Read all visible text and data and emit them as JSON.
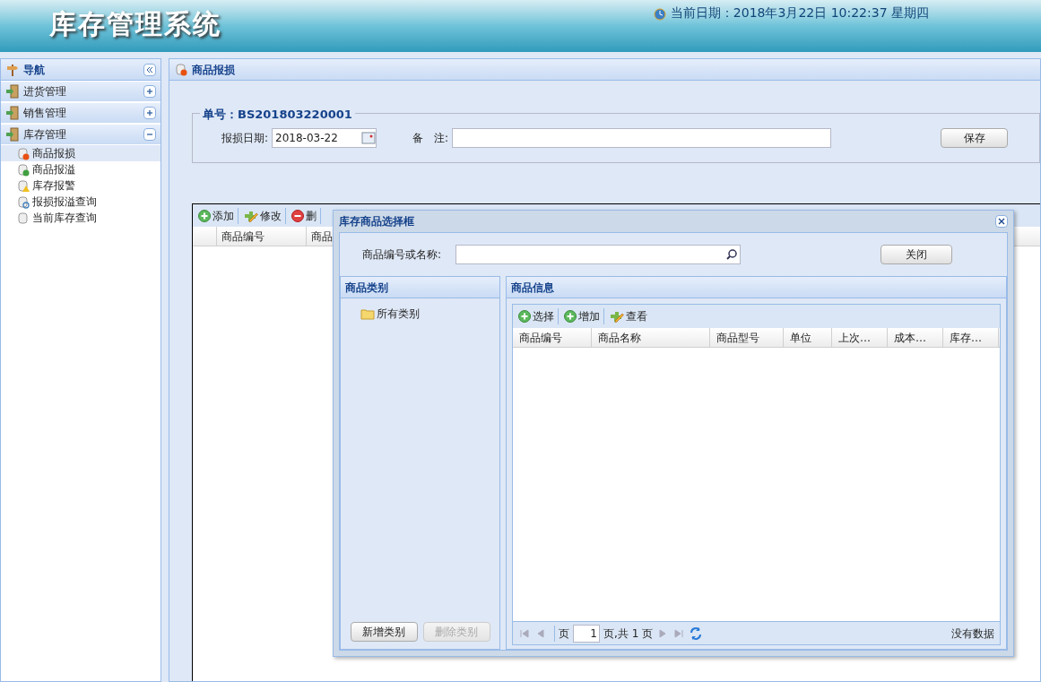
{
  "header": {
    "title": "库存管理系统",
    "datetime": "当前日期：2018年3月22日 10:22:37 星期四"
  },
  "sidebar": {
    "title": "导航",
    "groups": [
      {
        "label": "进货管理",
        "expanded": false
      },
      {
        "label": "销售管理",
        "expanded": false
      },
      {
        "label": "库存管理",
        "expanded": true,
        "children": [
          {
            "label": "商品报损",
            "selected": true,
            "kind": "minus"
          },
          {
            "label": "商品报溢",
            "selected": false,
            "kind": "plus"
          },
          {
            "label": "库存报警",
            "selected": false,
            "kind": "warn"
          },
          {
            "label": "报损报溢查询",
            "selected": false,
            "kind": "search"
          },
          {
            "label": "当前库存查询",
            "selected": false,
            "kind": "plain"
          }
        ]
      }
    ]
  },
  "main": {
    "title": "商品报损",
    "order_no": "单号：BS201803220001",
    "date_label": "报损日期:",
    "date_value": "2018-03-22",
    "remark_label": "备　注:",
    "save": "保存",
    "toolbar": [
      {
        "label": "添加",
        "kind": "add"
      },
      {
        "label": "修改",
        "kind": "edit"
      },
      {
        "label": "删",
        "kind": "delete"
      }
    ],
    "columns": [
      "商品编号",
      "商品"
    ]
  },
  "dialog": {
    "title": "库存商品选择框",
    "search_label": "商品编号或名称:",
    "close": "关闭",
    "category_panel": {
      "title": "商品类别",
      "tree": [
        {
          "label": "所有类别"
        }
      ],
      "buttons": [
        {
          "label": "新增类别",
          "disabled": false
        },
        {
          "label": "删除类别",
          "disabled": true
        }
      ]
    },
    "goods_panel": {
      "title": "商品信息",
      "toolbar": [
        {
          "label": "选择",
          "kind": "add"
        },
        {
          "label": "增加",
          "kind": "add"
        },
        {
          "label": "查看",
          "kind": "edit"
        }
      ],
      "columns": [
        "商品编号",
        "商品名称",
        "商品型号",
        "单位",
        "上次…",
        "成本…",
        "库存…"
      ],
      "pager": {
        "page_label": "页",
        "page": "1",
        "total": "页,共 1 页",
        "status": "没有数据"
      }
    }
  }
}
